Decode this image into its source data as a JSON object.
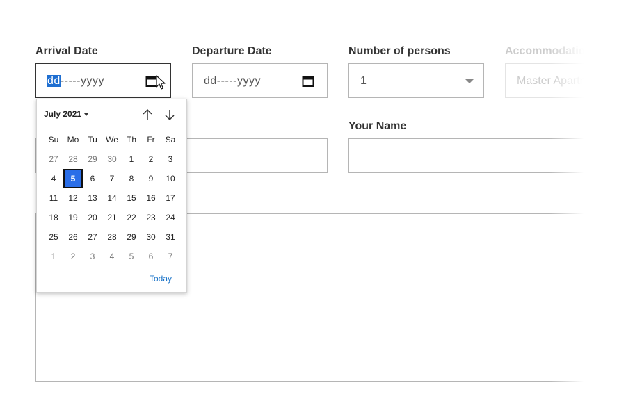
{
  "fields": {
    "arrival": {
      "label": "Arrival Date",
      "day": "dd",
      "rest": "-----yyyy"
    },
    "departure": {
      "label": "Departure Date",
      "value": "dd-----yyyy"
    },
    "persons": {
      "label": "Number of persons",
      "value": "1"
    },
    "accommodation": {
      "label": "Accommodation",
      "placeholder": "Master Apartment"
    },
    "name": {
      "label": "Your Name"
    }
  },
  "calendar": {
    "month_label": "July 2021",
    "weekdays": [
      "Su",
      "Mo",
      "Tu",
      "We",
      "Th",
      "Fr",
      "Sa"
    ],
    "weeks": [
      [
        "27",
        "28",
        "29",
        "30",
        "1",
        "2",
        "3"
      ],
      [
        "4",
        "5",
        "6",
        "7",
        "8",
        "9",
        "10"
      ],
      [
        "11",
        "12",
        "13",
        "14",
        "15",
        "16",
        "17"
      ],
      [
        "18",
        "19",
        "20",
        "21",
        "22",
        "23",
        "24"
      ],
      [
        "25",
        "26",
        "27",
        "28",
        "29",
        "30",
        "31"
      ],
      [
        "1",
        "2",
        "3",
        "4",
        "5",
        "6",
        "7"
      ]
    ],
    "selected_day": "5",
    "today_label": "Today"
  },
  "colors": {
    "selection": "#1f6fd1",
    "selected_day_bg": "#2a6ee8",
    "today_link": "#1a73c8"
  }
}
